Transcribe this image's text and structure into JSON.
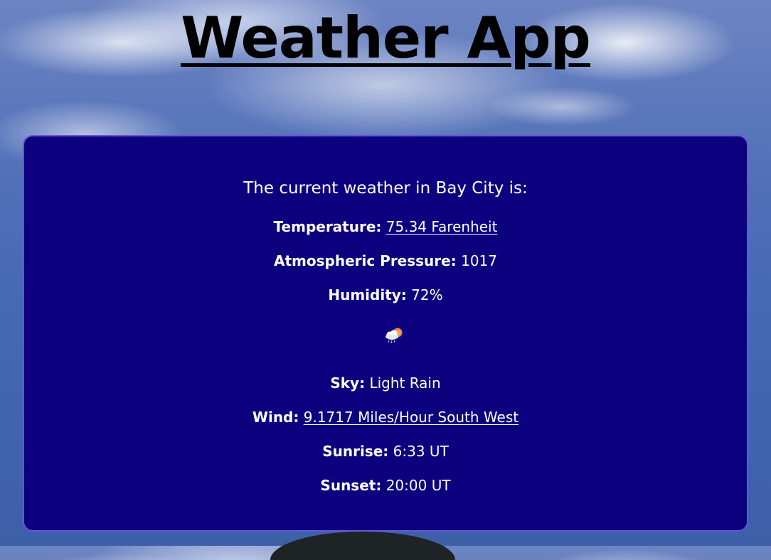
{
  "app": {
    "title": "Weather App"
  },
  "weather": {
    "intro": "The current weather in Bay City is:",
    "temperature": {
      "label": "Temperature:",
      "value": "75.34 Farenheit"
    },
    "pressure": {
      "label": "Atmospheric Pressure:",
      "value": "1017"
    },
    "humidity": {
      "label": "Humidity:",
      "value": "72%"
    },
    "icon": "rain-cloud-sun-icon",
    "sky": {
      "label": "Sky:",
      "value": "Light Rain"
    },
    "wind": {
      "label": "Wind:",
      "value": "9.1717 Miles/Hour South West"
    },
    "sunrise": {
      "label": "Sunrise:",
      "value": "6:33 UT"
    },
    "sunset": {
      "label": "Sunset:",
      "value": "20:00 UT"
    }
  },
  "colors": {
    "card_background": "#0c007f",
    "card_border": "#6a55d6",
    "text": "#ffffff",
    "title": "#000000"
  }
}
